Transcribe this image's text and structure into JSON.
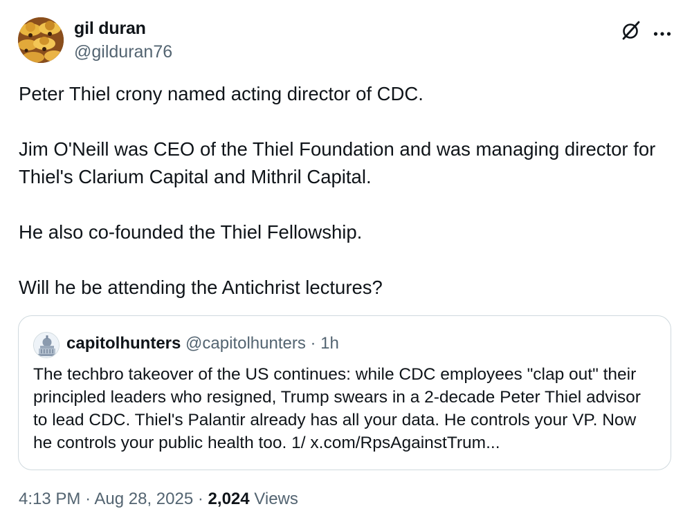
{
  "author": {
    "display_name": "gil duran",
    "handle": "@gilduran76",
    "avatar_icon": "avatar-image"
  },
  "actions": {
    "grok_icon": "grok-icon",
    "more_icon": "more-horizontal-icon"
  },
  "tweet": {
    "paragraphs": [
      "Peter Thiel crony named acting director of CDC.",
      "Jim O'Neill was CEO of the Thiel Foundation and was managing director for Thiel's Clarium Capital and Mithril Capital.",
      "He also co-founded the Thiel Fellowship.",
      "Will he be attending the Antichrist lectures?"
    ]
  },
  "quote": {
    "display_name": "capitolhunters",
    "handle": "@capitolhunters",
    "separator": "·",
    "time": "1h",
    "avatar_icon": "capitol-building-icon",
    "text": "The techbro takeover of the US continues: while CDC employees \"clap out\" their principled leaders who resigned, Trump swears in a 2-decade Peter Thiel advisor to lead CDC. Thiel's Palantir already has all your data. He controls your VP. Now he controls your public health too. 1/ x.com/RpsAgainstTrum..."
  },
  "meta": {
    "time": "4:13 PM",
    "separator": "·",
    "date": "Aug 28, 2025",
    "views_count": "2,024",
    "views_label": "Views"
  },
  "colors": {
    "text_primary": "#0f1419",
    "text_secondary": "#536471",
    "border": "#cfd9de"
  }
}
